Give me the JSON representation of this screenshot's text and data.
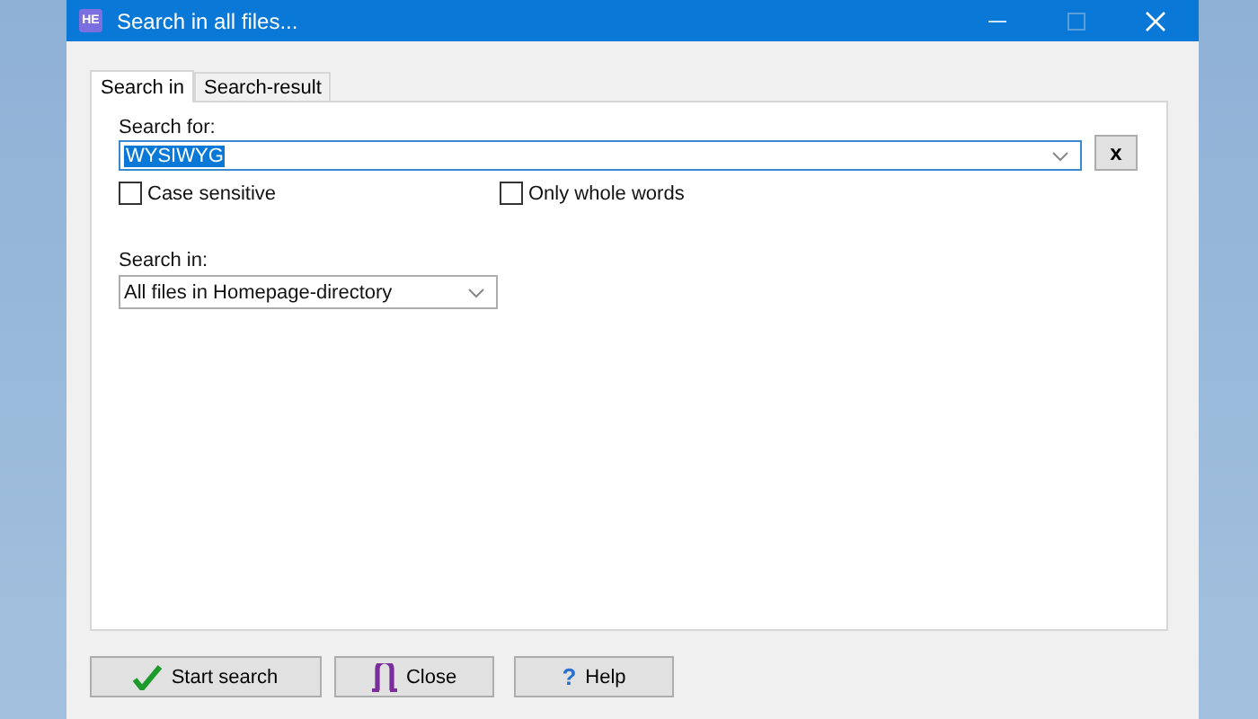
{
  "window": {
    "app_badge": "HE",
    "title": "Search in all files...",
    "maximize_disabled": true
  },
  "tabs": [
    {
      "label": "Search in",
      "selected": true
    },
    {
      "label": "Search-result",
      "selected": false
    }
  ],
  "search_for": {
    "label": "Search for:",
    "value": "WYSIWYG",
    "value_selected": true,
    "clear_button": "x"
  },
  "options": [
    {
      "label": "Case sensitive",
      "checked": false
    },
    {
      "label": "Only whole words",
      "checked": false
    }
  ],
  "search_in": {
    "label": "Search in:",
    "value": "All files in Homepage-directory"
  },
  "buttons": [
    {
      "kind": "start",
      "label": "Start search"
    },
    {
      "kind": "close",
      "label": "Close"
    },
    {
      "kind": "help",
      "icon": "?",
      "label": "Help"
    }
  ]
}
